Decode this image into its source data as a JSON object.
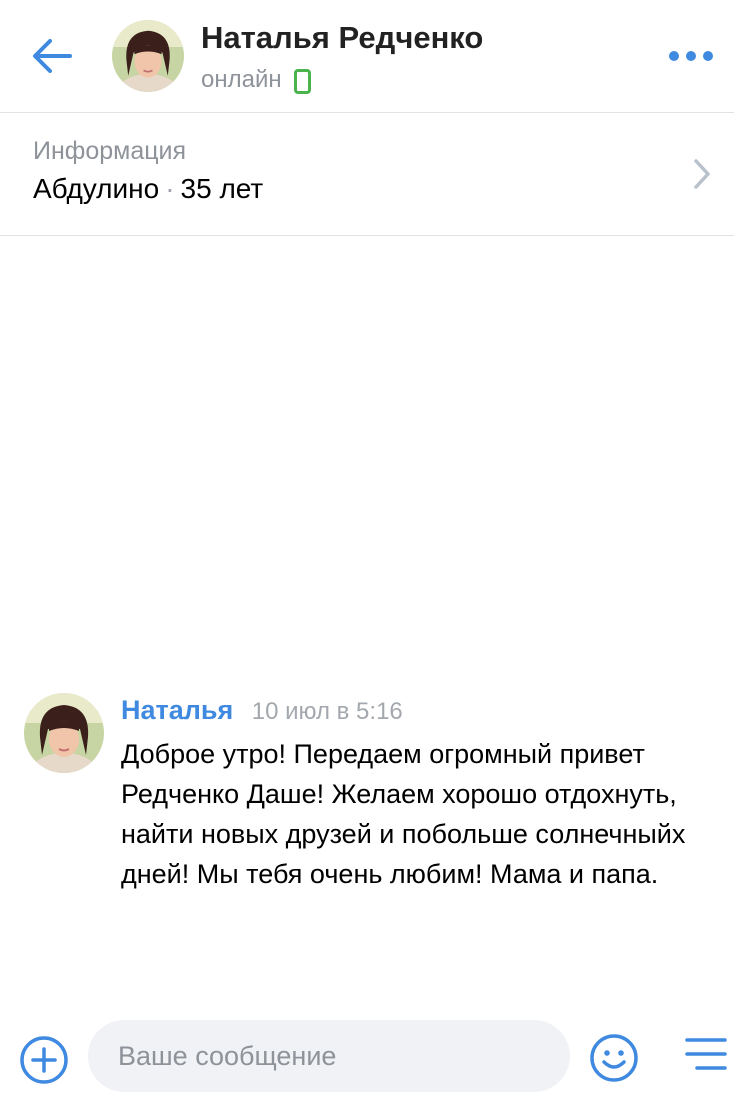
{
  "header": {
    "name": "Наталья Редченко",
    "status": "онлайн",
    "icons": {
      "back": "back-arrow-icon",
      "more": "more-dots-icon",
      "status": "mobile-online-icon"
    }
  },
  "info": {
    "label": "Информация",
    "city": "Абдулино",
    "separator": "·",
    "age": "35 лет"
  },
  "messages": [
    {
      "author": "Наталья",
      "time": "10 июл в 5:16",
      "text": "Доброе утро! Передаем огромный привет Редченко Даше! Желаем хорошо отдохнуть, найти новых друзей и побольше солнечныйх дней! Мы тебя очень любим! Мама и папа."
    }
  ],
  "composer": {
    "placeholder": "Ваше сообщение",
    "value": ""
  },
  "colors": {
    "accent": "#3f8ae0",
    "online": "#4bb34b",
    "secondary_text": "#8e939a",
    "input_background": "#f0f2f5"
  }
}
